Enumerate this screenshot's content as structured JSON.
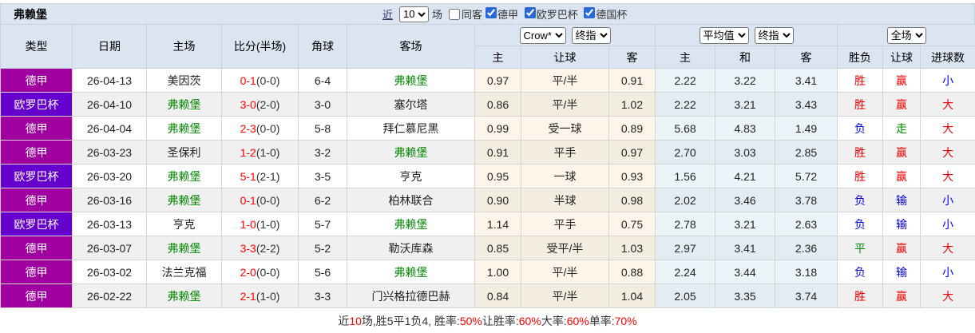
{
  "title": "弗赖堡",
  "controls": {
    "recent_label": "近",
    "recent_count": "10",
    "matches_label": "场",
    "same_away_label": "同客",
    "filters": [
      "德甲",
      "欧罗巴杯",
      "德国杯"
    ]
  },
  "selects": {
    "bookmaker": "Crow*",
    "bookmaker_final": "终指",
    "average": "平均值",
    "average_final": "终指",
    "scope": "全场"
  },
  "columns": {
    "type": "类型",
    "date": "日期",
    "home": "主场",
    "score": "比分(半场)",
    "corner": "角球",
    "away": "客场",
    "odds_home": "主",
    "odds_handicap": "让球",
    "odds_away": "客",
    "avg_home": "主",
    "avg_draw": "和",
    "avg_away": "客",
    "wdl": "胜负",
    "handicap_result": "让球",
    "goals": "进球数"
  },
  "league_colors": {
    "德甲": "#a000a0",
    "欧罗巴杯": "#6600cc"
  },
  "team_colors": {
    "弗赖堡": "#008800"
  },
  "value_colors": {
    "胜": "#ee0000",
    "负": "#0000dd",
    "平": "#008800",
    "赢": "#ee0000",
    "输": "#0000dd",
    "走": "#008800",
    "大": "#ee0000",
    "小": "#0000dd"
  },
  "rows": [
    {
      "league": "德甲",
      "date": "26-04-13",
      "home": "美因茨",
      "score": "0-1",
      "half": "(0-0)",
      "corner": "6-4",
      "away": "弗赖堡",
      "crow_home": "0.97",
      "crow_hcp": "平/半",
      "crow_away": "0.91",
      "avg_home": "2.22",
      "avg_draw": "3.22",
      "avg_away": "3.41",
      "wl": "胜",
      "hcp": "赢",
      "goals": "小"
    },
    {
      "league": "欧罗巴杯",
      "date": "26-04-10",
      "home": "弗赖堡",
      "score": "3-0",
      "half": "(2-0)",
      "corner": "3-0",
      "away": "塞尔塔",
      "crow_home": "0.86",
      "crow_hcp": "平/半",
      "crow_away": "1.02",
      "avg_home": "2.22",
      "avg_draw": "3.21",
      "avg_away": "3.43",
      "wl": "胜",
      "hcp": "赢",
      "goals": "大"
    },
    {
      "league": "德甲",
      "date": "26-04-04",
      "home": "弗赖堡",
      "score": "2-3",
      "half": "(0-0)",
      "corner": "5-8",
      "away": "拜仁慕尼黑",
      "crow_home": "0.99",
      "crow_hcp": "受一球",
      "crow_away": "0.89",
      "avg_home": "5.68",
      "avg_draw": "4.83",
      "avg_away": "1.49",
      "wl": "负",
      "hcp": "走",
      "goals": "大"
    },
    {
      "league": "德甲",
      "date": "26-03-23",
      "home": "圣保利",
      "score": "1-2",
      "half": "(1-0)",
      "corner": "3-2",
      "away": "弗赖堡",
      "crow_home": "0.91",
      "crow_hcp": "平手",
      "crow_away": "0.97",
      "avg_home": "2.70",
      "avg_draw": "3.03",
      "avg_away": "2.85",
      "wl": "胜",
      "hcp": "赢",
      "goals": "大"
    },
    {
      "league": "欧罗巴杯",
      "date": "26-03-20",
      "home": "弗赖堡",
      "score": "5-1",
      "half": "(2-1)",
      "corner": "3-5",
      "away": "亨克",
      "crow_home": "0.95",
      "crow_hcp": "一球",
      "crow_away": "0.93",
      "avg_home": "1.56",
      "avg_draw": "4.21",
      "avg_away": "5.72",
      "wl": "胜",
      "hcp": "赢",
      "goals": "大"
    },
    {
      "league": "德甲",
      "date": "26-03-16",
      "home": "弗赖堡",
      "score": "0-1",
      "half": "(0-0)",
      "corner": "6-2",
      "away": "柏林联合",
      "crow_home": "0.90",
      "crow_hcp": "半球",
      "crow_away": "0.98",
      "avg_home": "2.02",
      "avg_draw": "3.46",
      "avg_away": "3.78",
      "wl": "负",
      "hcp": "输",
      "goals": "小"
    },
    {
      "league": "欧罗巴杯",
      "date": "26-03-13",
      "home": "亨克",
      "score": "1-0",
      "half": "(1-0)",
      "corner": "5-7",
      "away": "弗赖堡",
      "crow_home": "1.14",
      "crow_hcp": "平手",
      "crow_away": "0.75",
      "avg_home": "2.78",
      "avg_draw": "3.21",
      "avg_away": "2.63",
      "wl": "负",
      "hcp": "输",
      "goals": "小"
    },
    {
      "league": "德甲",
      "date": "26-03-07",
      "home": "弗赖堡",
      "score": "3-3",
      "half": "(2-2)",
      "corner": "5-2",
      "away": "勒沃库森",
      "crow_home": "0.85",
      "crow_hcp": "受平/半",
      "crow_away": "1.03",
      "avg_home": "2.97",
      "avg_draw": "3.41",
      "avg_away": "2.36",
      "wl": "平",
      "hcp": "赢",
      "goals": "大"
    },
    {
      "league": "德甲",
      "date": "26-03-02",
      "home": "法兰克福",
      "score": "2-0",
      "half": "(0-0)",
      "corner": "5-6",
      "away": "弗赖堡",
      "crow_home": "1.00",
      "crow_hcp": "平/半",
      "crow_away": "0.88",
      "avg_home": "2.24",
      "avg_draw": "3.44",
      "avg_away": "3.18",
      "wl": "负",
      "hcp": "输",
      "goals": "小"
    },
    {
      "league": "德甲",
      "date": "26-02-22",
      "home": "弗赖堡",
      "score": "2-1",
      "half": "(1-0)",
      "corner": "3-3",
      "away": "门兴格拉德巴赫",
      "crow_home": "0.84",
      "crow_hcp": "平/半",
      "crow_away": "1.04",
      "avg_home": "2.05",
      "avg_draw": "3.35",
      "avg_away": "3.74",
      "wl": "胜",
      "hcp": "赢",
      "goals": "大"
    }
  ],
  "footer": {
    "parts": [
      {
        "text": "近"
      },
      {
        "text": "10"
      },
      {
        "text": "场,胜5平1负4, 胜率:"
      },
      {
        "text": "50%"
      },
      {
        "text": " 让胜率:"
      },
      {
        "text": "60%"
      },
      {
        "text": " 大率:"
      },
      {
        "text": "60%"
      },
      {
        "text": " 单率:"
      },
      {
        "text": "70%"
      }
    ]
  }
}
